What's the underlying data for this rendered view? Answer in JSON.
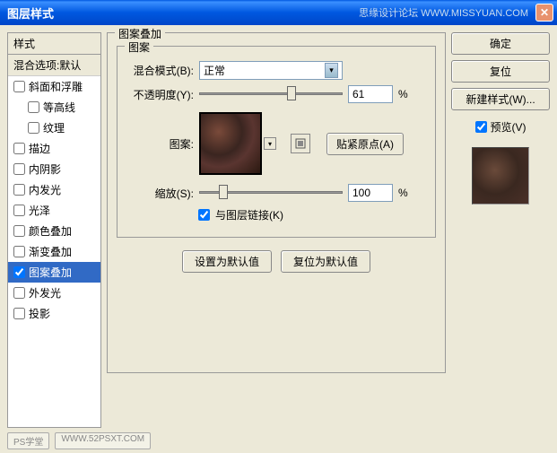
{
  "window": {
    "title": "图层样式",
    "brand": "思缘设计论坛  WWW.MISSYUAN.COM"
  },
  "left": {
    "header": "样式",
    "subheader": "混合选项:默认",
    "items": [
      {
        "label": "斜面和浮雕",
        "checked": false,
        "selected": false
      },
      {
        "label": "等高线",
        "checked": false,
        "selected": false,
        "sub": true
      },
      {
        "label": "纹理",
        "checked": false,
        "selected": false,
        "sub": true
      },
      {
        "label": "描边",
        "checked": false,
        "selected": false
      },
      {
        "label": "内阴影",
        "checked": false,
        "selected": false
      },
      {
        "label": "内发光",
        "checked": false,
        "selected": false
      },
      {
        "label": "光泽",
        "checked": false,
        "selected": false
      },
      {
        "label": "颜色叠加",
        "checked": false,
        "selected": false
      },
      {
        "label": "渐变叠加",
        "checked": false,
        "selected": false
      },
      {
        "label": "图案叠加",
        "checked": true,
        "selected": true
      },
      {
        "label": "外发光",
        "checked": false,
        "selected": false
      },
      {
        "label": "投影",
        "checked": false,
        "selected": false
      }
    ]
  },
  "main": {
    "section_title": "图案叠加",
    "pattern_title": "图案",
    "blend_mode_label": "混合模式(B):",
    "blend_mode_value": "正常",
    "opacity_label": "不透明度(Y):",
    "opacity_value": "61",
    "opacity_unit": "%",
    "pattern_label": "图案:",
    "snap_origin": "贴紧原点(A)",
    "scale_label": "缩放(S):",
    "scale_value": "100",
    "scale_unit": "%",
    "link_layer": "与图层链接(K)",
    "set_default": "设置为默认值",
    "reset_default": "复位为默认值"
  },
  "right": {
    "ok": "确定",
    "reset": "复位",
    "new_style": "新建样式(W)...",
    "preview": "预览(V)"
  },
  "footer": {
    "tag1": "PS学堂",
    "tag2": "WWW.52PSXT.COM"
  }
}
